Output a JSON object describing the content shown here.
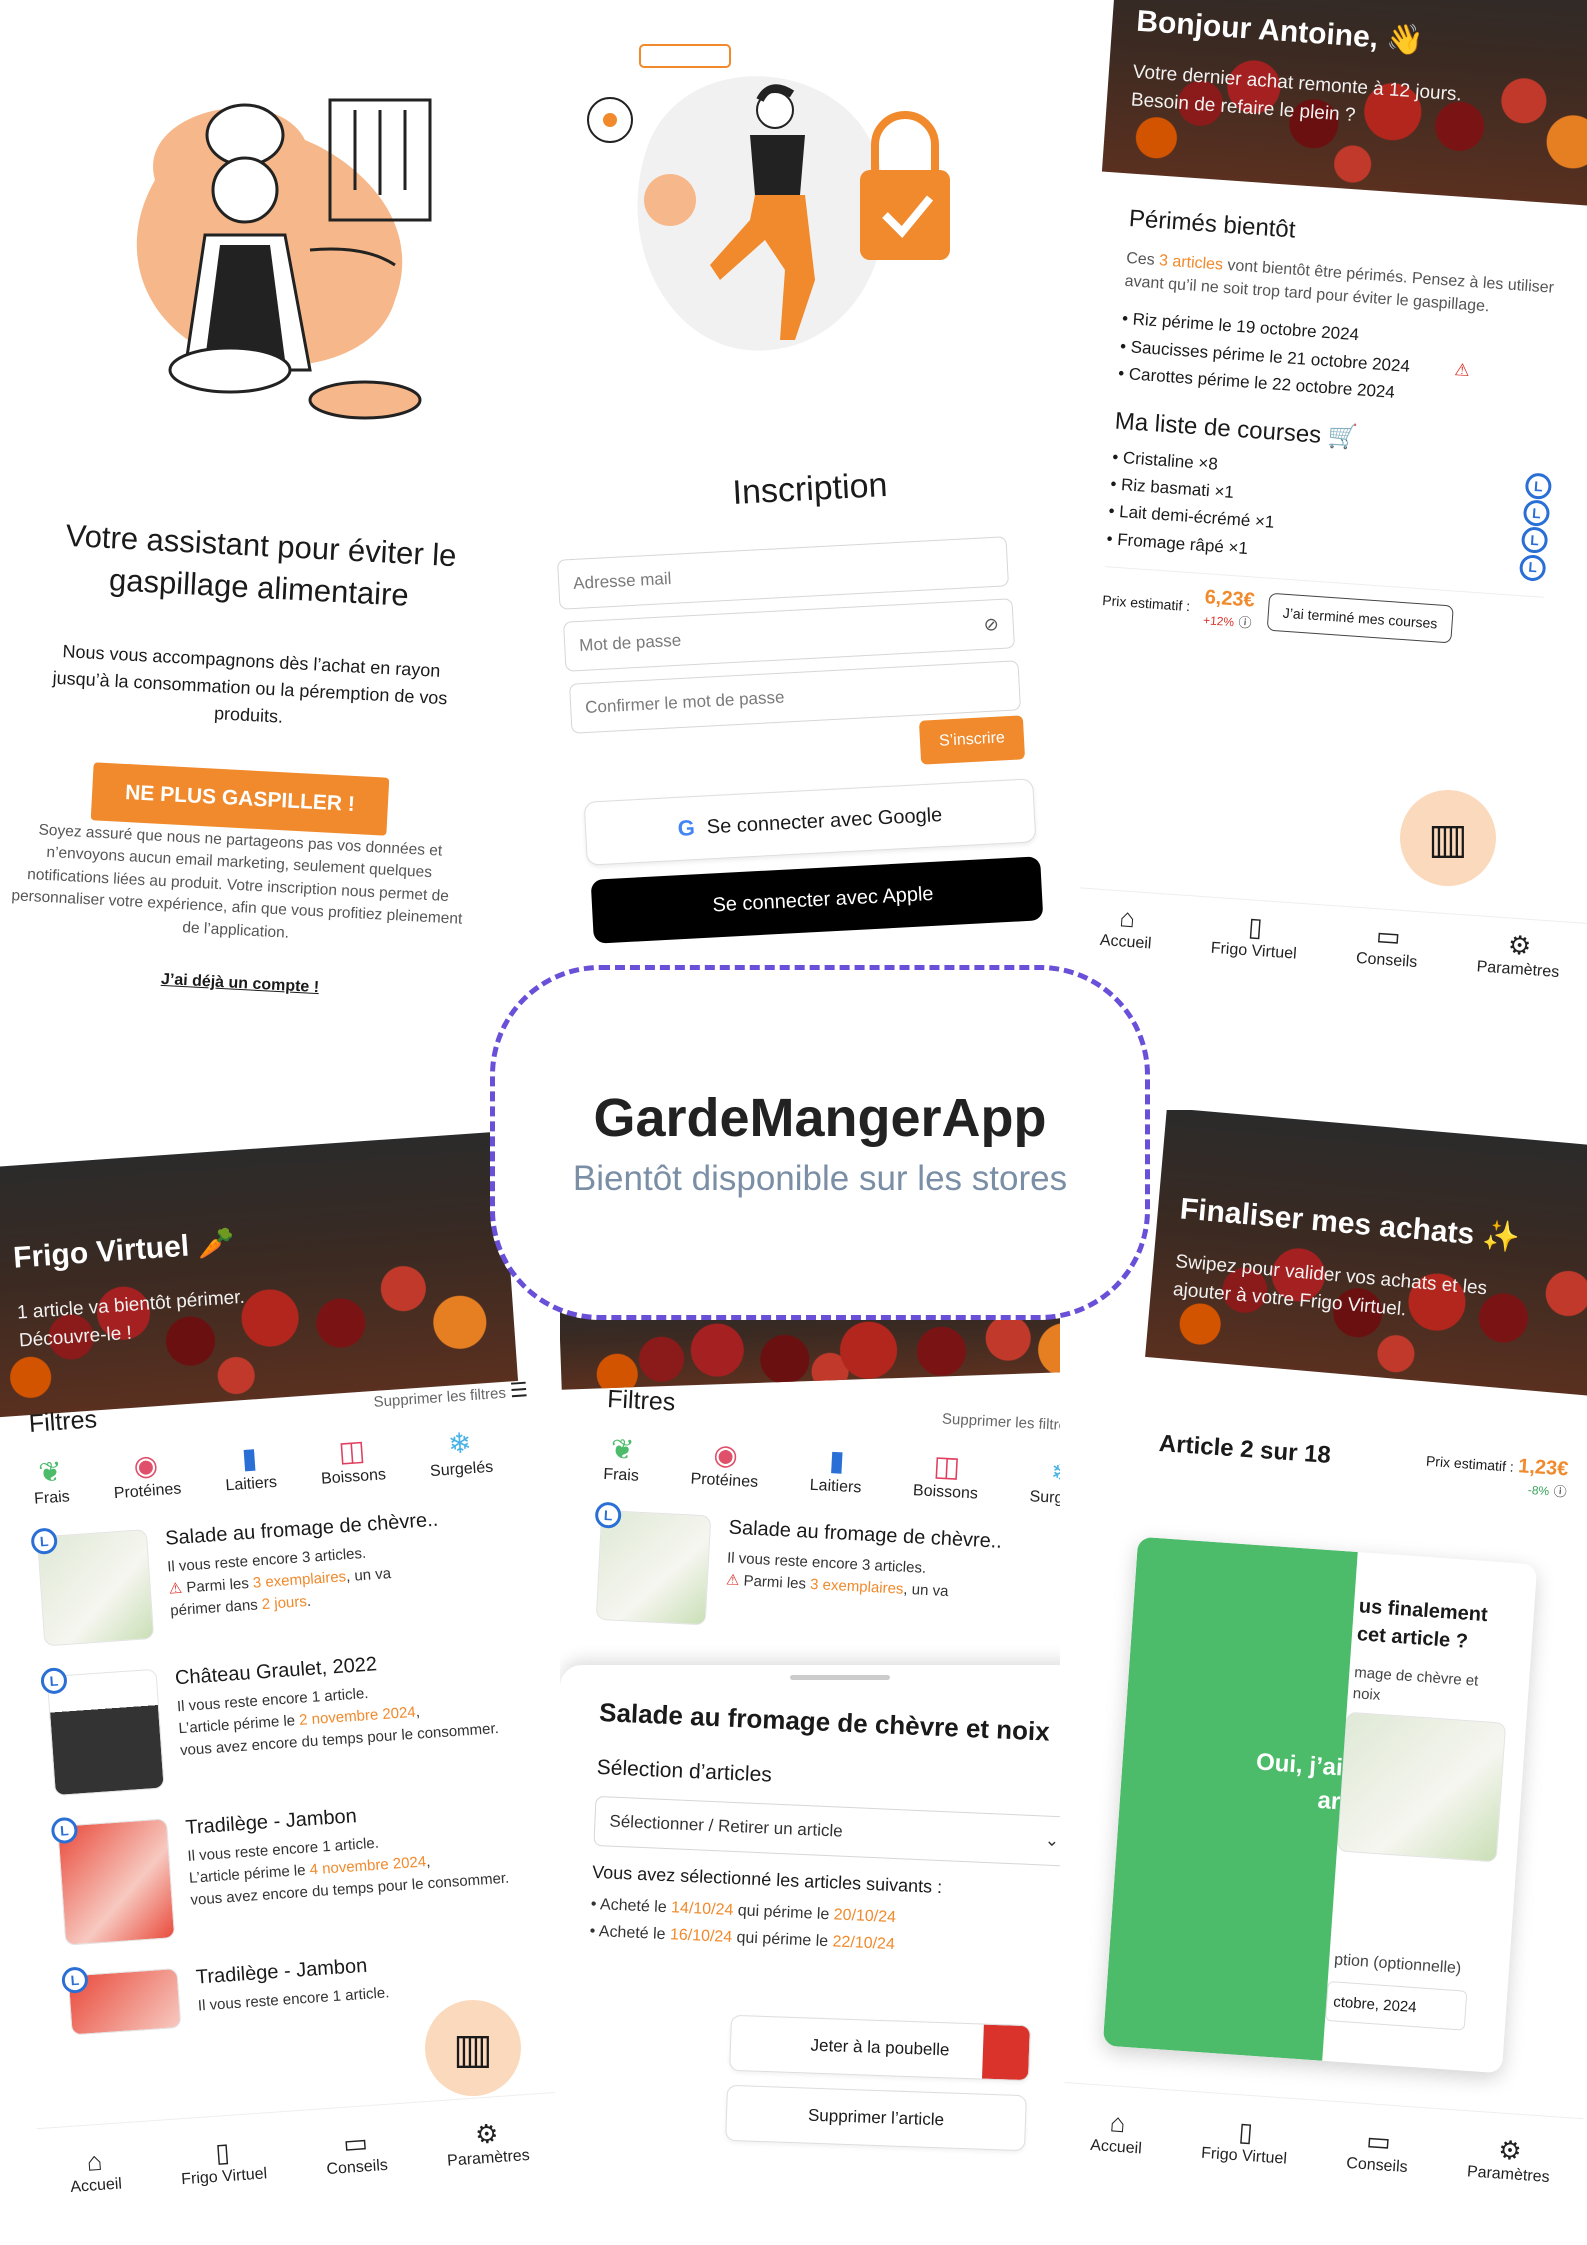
{
  "onboarding": {
    "title": "Votre assistant pour éviter le gaspillage alimentaire",
    "subtitle": "Nous vous accompagnons dès l’achat en rayon jusqu’à la consommation ou la péremption de vos produits.",
    "cta": "NE PLUS GASPILLER !",
    "privacy": "Soyez assuré que nous ne partageons pas vos données et n’envoyons aucun email marketing, seulement quelques notifications liées au produit. Votre inscription nous permet de personnaliser votre expérience, afin que vous profitiez pleinement de l’application.",
    "login_link": "J’ai déjà un compte !"
  },
  "signup": {
    "title": "Inscription",
    "email_placeholder": "Adresse mail",
    "password_placeholder": "Mot de passe",
    "confirm_placeholder": "Confirmer le mot de passe",
    "submit": "S’inscrire",
    "google": "Se connecter avec Google",
    "apple": "Se connecter avec Apple"
  },
  "home": {
    "greeting": "Bonjour Antoine, 👋",
    "sub1": "Votre dernier achat remonte à 12 jours.",
    "sub2": "Besoin de refaire le plein ?",
    "expiring_title": "Périmés bientôt",
    "expiring_text_pre": "Ces ",
    "expiring_count": "3 articles",
    "expiring_text_post": " vont bientôt être périmés. Pensez à les utiliser avant qu’il ne soit trop tard pour éviter le gaspillage.",
    "expiring_items": [
      "Riz périme le 19 octobre 2024",
      "Saucisses périme le 21 octobre 2024",
      "Carottes périme le 22 octobre 2024"
    ],
    "list_title": "Ma liste de courses 🛒",
    "list_items": [
      "Cristaline ×8",
      "Riz basmati ×1",
      "Lait demi-écrémé ×1",
      "Fromage râpé ×1"
    ],
    "price_label": "Prix estimatif :",
    "price": "6,23€",
    "price_delta": "+12%",
    "done_button": "J’ai terminé mes courses",
    "nav": [
      "Accueil",
      "Frigo Virtuel",
      "Conseils",
      "Paramètres"
    ]
  },
  "center": {
    "app_name": "GardeMangerApp",
    "tagline": "Bientôt disponible sur les stores"
  },
  "fridge": {
    "title": "Frigo Virtuel 🥕",
    "sub1": "1 article va bientôt périmer.",
    "sub2": "Découvre-le !",
    "filters_title": "Filtres",
    "clear_filters": "Supprimer les filtres",
    "filters": [
      "Frais",
      "Protéines",
      "Laitiers",
      "Boissons",
      "Surgelés"
    ],
    "items": [
      {
        "name": "Salade au fromage de chèvre..",
        "line1": "Il vous reste encore 3 articles.",
        "line2_pre": "Parmi les ",
        "line2_hl": "3 exemplaires",
        "line2_post": ", un va",
        "line3_pre": "périmer dans ",
        "line3_hl": "2 jours",
        "line3_post": "."
      },
      {
        "name": "Château Graulet, 2022",
        "line1": "Il vous reste encore 1 article.",
        "line2_pre": "L’article périme le ",
        "line2_hl": "2 novembre 2024",
        "line2_post": ",",
        "line3_pre": "vous avez encore du temps pour le consommer.",
        "line3_hl": "",
        "line3_post": ""
      },
      {
        "name": "Tradilège - Jambon",
        "line1": "Il vous reste encore 1 article.",
        "line2_pre": "L’article périme le ",
        "line2_hl": "4 novembre 2024",
        "line2_post": ",",
        "line3_pre": "vous avez encore du temps pour le consommer.",
        "line3_hl": "",
        "line3_post": ""
      },
      {
        "name": "Tradilège - Jambon",
        "line1": "Il vous reste encore 1 article.",
        "line2_pre": "",
        "line2_hl": "",
        "line2_post": "",
        "line3_pre": "",
        "line3_hl": "",
        "line3_post": ""
      }
    ],
    "nav": [
      "Accueil",
      "Frigo Virtuel",
      "Conseils",
      "Paramètres"
    ]
  },
  "detail": {
    "filters_title": "Filtres",
    "clear_filters": "Supprimer les filtres",
    "filters": [
      "Frais",
      "Protéines",
      "Laitiers",
      "Boissons",
      "Surgelés"
    ],
    "bg_item_name": "Salade au fromage de chèvre..",
    "bg_line1": "Il vous reste encore 3 articles.",
    "bg_line2_pre": "Parmi les ",
    "bg_line2_hl": "3 exemplaires",
    "bg_line2_post": ", un va",
    "sheet_title": "Salade au fromage de chèvre et noix",
    "selection_title": "Sélection d’articles",
    "select_placeholder": "Sélectionner / Retirer un article",
    "selected_intro": "Vous avez sélectionné les articles suivants :",
    "selected": [
      {
        "pre": "Acheté le ",
        "buy": "14/10/24",
        "mid": " qui périme le ",
        "exp": "20/10/24"
      },
      {
        "pre": "Acheté le ",
        "buy": "16/10/24",
        "mid": " qui périme le ",
        "exp": "22/10/24"
      }
    ],
    "trash_button": "Jeter à la poubelle",
    "delete_button": "Supprimer l’article"
  },
  "finalize": {
    "title": "Finaliser mes achats ✨",
    "sub1": "Swipez pour valider vos achats et les",
    "sub2": "ajouter à votre Frigo Virtuel.",
    "counter": "Article 2 sur 18",
    "price_label": "Prix estimatif :",
    "price": "1,23€",
    "price_delta": "-8%",
    "card_question": "…us finalement …cet article ?",
    "card_q1": "us finalement",
    "card_q2": "cet article ?",
    "card_desc1": "mage de chèvre et",
    "card_desc2": "noix",
    "swipe_label1": "Oui, j’ai",
    "swipe_label2": "ar",
    "date_label": "ption (optionnelle)",
    "date_value": "ctobre, 2024",
    "nav": [
      "Accueil",
      "Frigo Virtuel",
      "Conseils",
      "Paramètres"
    ]
  },
  "colors": {
    "accent": "#f08a2c",
    "purple": "#6a4fd8",
    "danger": "#d9332b",
    "green": "#4cbb6a",
    "blue": "#2a6fd6"
  }
}
